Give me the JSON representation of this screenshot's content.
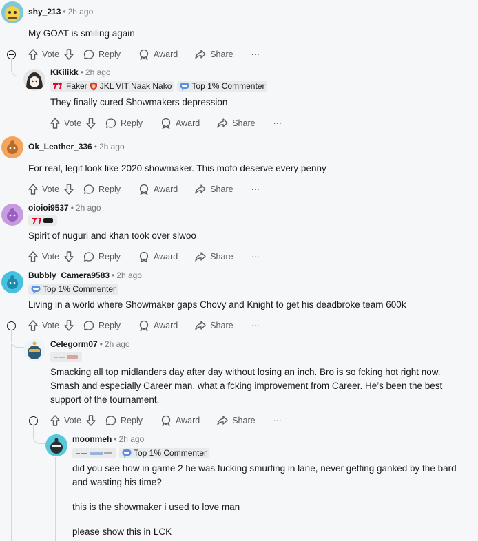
{
  "actions": {
    "vote": "Vote",
    "reply": "Reply",
    "award": "Award",
    "share": "Share",
    "more": "···"
  },
  "comments": [
    {
      "user": "shy_213",
      "time": "2h ago",
      "text": "My GOAT is smiling again"
    },
    {
      "user": "KKilikk",
      "time": "2h ago",
      "flair1": "Faker",
      "flair1b": "JKL VIT Naak Nako",
      "flair2": "Top 1% Commenter",
      "text": "They finally cured Showmakers depression"
    },
    {
      "user": "Ok_Leather_336",
      "time": "2h ago",
      "text": "For real, legit look like 2020 showmaker. This mofo deserve every penny"
    },
    {
      "user": "oioioi9537",
      "time": "2h ago",
      "text": "Spirit of nuguri and khan took over siwoo"
    },
    {
      "user": "Bubbly_Camera9583",
      "time": "2h ago",
      "flair2": "Top 1% Commenter",
      "text": "Living in a world where Showmaker gaps Chovy and Knight to get his deadbroke team 600k"
    },
    {
      "user": "Celegorm07",
      "time": "2h ago",
      "text1": "Smacking all top midlanders day after day without losing an inch. Bro is so fcking hot right now.",
      "text2": "Smash and especially Career man, what a fcking improvement from Career. He’s been the best",
      "text3": "support of the tournament."
    },
    {
      "user": "moonmeh",
      "time": "2h ago",
      "flair2": "Top 1% Commenter",
      "text1": "did you see how in game 2 he was fucking smurfing in lane, never getting ganked by the bard",
      "text2": "and wasting his time?",
      "text3": "this is the showmaker i used to love man",
      "text4": "please show this in LCK"
    }
  ],
  "colors": {
    "background": "#f6f7f8",
    "text": "#1a1a1b",
    "muted": "#7c7c7c",
    "action": "#57585a",
    "flair_bg": "#e9eaeb"
  }
}
